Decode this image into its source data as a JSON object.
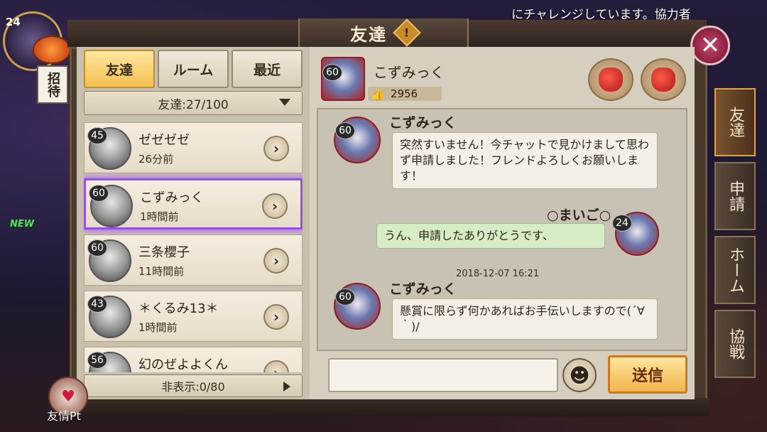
{
  "marquee": "にチャレンジしています。協力者",
  "hud": {
    "level": "24",
    "invite_label": "招待",
    "new_tag": "NEW",
    "friendship_label": "友情Pt"
  },
  "dialog": {
    "title": "友達",
    "help": "!",
    "close": "✕"
  },
  "tabs": [
    {
      "label": "友達",
      "active": true
    },
    {
      "label": "ルーム",
      "active": false
    },
    {
      "label": "最近",
      "active": false
    }
  ],
  "friend_count": "友達:27/100",
  "hidden_count": "非表示:0/80",
  "friends": [
    {
      "level": "45",
      "name": "ゼゼゼゼ",
      "time": "26分前"
    },
    {
      "level": "60",
      "name": "こずみっく",
      "time": "1時間前",
      "selected": true
    },
    {
      "level": "60",
      "name": "三条櫻子",
      "time": "11時間前"
    },
    {
      "level": "43",
      "name": "＊くるみ13＊",
      "time": "1時間前"
    },
    {
      "level": "56",
      "name": "幻のぜよよくん",
      "time": ""
    }
  ],
  "profile": {
    "level": "60",
    "name": "こずみっく",
    "likes": "2956"
  },
  "chat": {
    "messages": [
      {
        "sender": "こずみっく",
        "level": "60",
        "text": "突然すいません！今チャットで見かけまして思わず申請しました！フレンドよろしくお願いします！",
        "mine": false
      },
      {
        "sender": "○まいご○",
        "level": "24",
        "text": "うん、申請したありがとうです、",
        "mine": true
      },
      {
        "timestamp": "2018-12-07 16:21",
        "sender": "こずみっく",
        "level": "60",
        "text": "懸賞に限らず何かあればお手伝いしますので(´∀｀)/",
        "mine": false
      }
    ]
  },
  "input": {
    "placeholder": ""
  },
  "send_label": "送信",
  "side_tabs": [
    {
      "label": "友達",
      "active": true
    },
    {
      "label": "申請",
      "active": false
    },
    {
      "label": "ホーム",
      "active": false
    },
    {
      "label": "協戦",
      "active": false
    }
  ]
}
